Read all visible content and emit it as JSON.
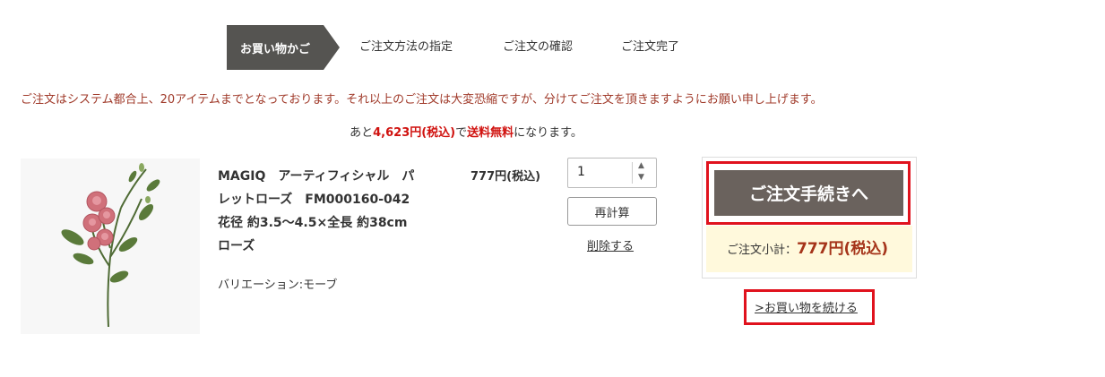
{
  "steps": {
    "active": "お買い物かご",
    "items": [
      "ご注文方法の指定",
      "ご注文の確認",
      "ご注文完了"
    ]
  },
  "notice": "ご注文はシステム都合上、20アイテムまでとなっております。それ以上のご注文は大変恐縮ですが、分けてご注文を頂きますようにお願い申し上げます。",
  "shipping": {
    "prefix": "あと",
    "amount": "4,623円(税込)",
    "middle": "で",
    "free_shipping": "送料無料",
    "suffix": "になります。"
  },
  "product": {
    "title_line1": "MAGIQ　アーティフィシャル　パ",
    "title_line2": "レットローズ　FM000160-042",
    "title_line3": "花径 約3.5～4.5×全長 約38cm",
    "title_line4": "ローズ",
    "variation": "バリエーション:モーブ",
    "price": "777円(税込)",
    "quantity": "1",
    "recalc_label": "再計算",
    "delete_label": "削除する"
  },
  "summary": {
    "checkout_label": "ご注文手続きへ",
    "subtotal_label": "ご注文小計：",
    "subtotal_amount": "777円(税込)",
    "continue_label": ">お買い物を続ける"
  },
  "colors": {
    "step_active_bg": "#555451",
    "checkout_bg": "#6a625d",
    "highlight_border": "#e0121d",
    "notice_text": "#a03a2a",
    "summary_bg": "#fff9dc"
  }
}
